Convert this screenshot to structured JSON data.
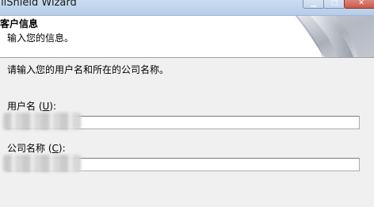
{
  "window": {
    "title": "InstallShield Wizard",
    "title_visible": "tallShield Wizard"
  },
  "header": {
    "title": "客户信息",
    "subtitle": "输入您的信息。"
  },
  "main": {
    "instruction": "请输入您的用户名和所在的公司名称。",
    "user_name": {
      "label_prefix": "用户名 (",
      "label_accel": "U",
      "label_suffix": "):",
      "value": ""
    },
    "company": {
      "label_prefix": "公司名称 (",
      "label_accel": "C",
      "label_suffix": "):",
      "value": ""
    }
  }
}
